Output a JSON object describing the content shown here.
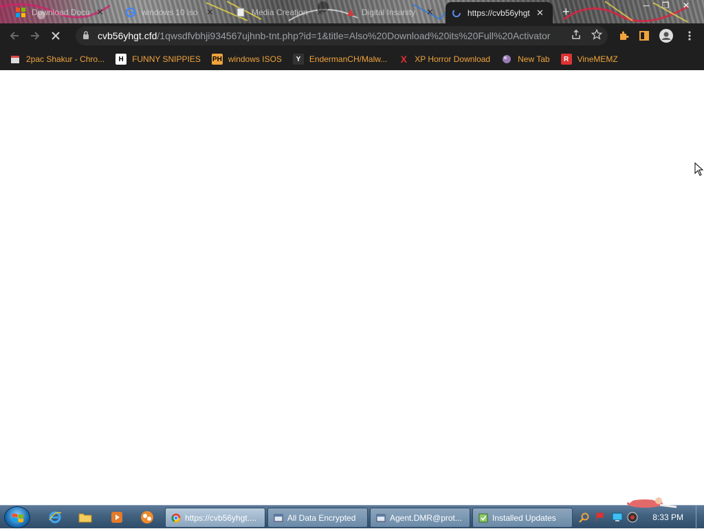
{
  "tabs": [
    {
      "title": "Download Documents",
      "favicon": "ms-logo-icon"
    },
    {
      "title": "windows 10 iso",
      "favicon": "google-icon"
    },
    {
      "title": "Media Creation Tool",
      "favicon": "page-icon"
    },
    {
      "title": "Digital Insanity",
      "favicon": "red-icon"
    },
    {
      "title": "https://cvb56yhgt",
      "favicon": "loading-icon",
      "active": true
    }
  ],
  "toolbar": {
    "url_host": "cvb56yhgt.cfd",
    "url_path": "/1qwsdfvbhji934567ujhnb-tnt.php?id=1&title=Also%20Download%20its%20Full%20Activator"
  },
  "bookmarks": [
    {
      "label": "2pac Shakur - Chro...",
      "icon": "store-icon"
    },
    {
      "label": "FUNNY SNIPPIES",
      "icon": "h-icon"
    },
    {
      "label": "windows ISOS",
      "icon": "ph-icon"
    },
    {
      "label": "EndermanCH/Malw...",
      "icon": "yt-icon"
    },
    {
      "label": "XP Horror Download",
      "icon": "x-icon"
    },
    {
      "label": "New Tab",
      "icon": "globe-icon"
    },
    {
      "label": "VineMEMZ",
      "icon": "r-icon"
    }
  ],
  "taskbar": {
    "tasks": [
      {
        "label": "https://cvb56yhgt....",
        "icon": "chrome-icon",
        "active": true
      },
      {
        "label": "All Data Encrypted",
        "icon": "window-icon"
      },
      {
        "label": "Agent.DMR@prot...",
        "icon": "window-icon"
      },
      {
        "label": "Installed Updates",
        "icon": "updates-icon"
      }
    ],
    "clock": "8:33 PM"
  },
  "colors": {
    "chrome_dark": "#1f1f1f",
    "bookmark_text": "#f0a43c",
    "taskbar": "#41617f"
  }
}
